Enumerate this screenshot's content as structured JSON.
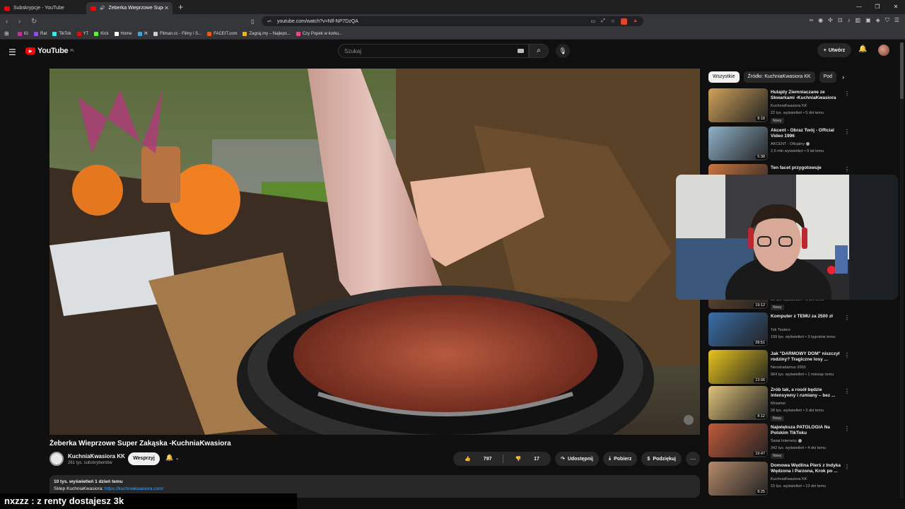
{
  "browser": {
    "tabs": [
      {
        "title": "Subskrypcje - YouTube",
        "active": false
      },
      {
        "title": "Żeberka Wieprzowe Super Za",
        "active": true
      }
    ],
    "new_tab": "+",
    "window_controls": [
      "—",
      "❐",
      "✕"
    ],
    "url": "youtube.com/watch?v=Nlf-NP7DzQA",
    "bookmarks": [
      {
        "label": "IG",
        "color": "#d6249f"
      },
      {
        "label": "Rat",
        "color": "#9146ff"
      },
      {
        "label": "TikTok",
        "color": "#25f4ee"
      },
      {
        "label": "YT",
        "color": "#ff0000"
      },
      {
        "label": "Kick",
        "color": "#53fc18"
      },
      {
        "label": "Home",
        "color": "#ffffff"
      },
      {
        "label": "Ж",
        "color": "#3aa7e0"
      },
      {
        "label": "Filman.cc - Filmy i S...",
        "color": "#cccccc"
      },
      {
        "label": "FACEIT.com",
        "color": "#ff5500"
      },
      {
        "label": "Zagraj.my – Najleps...",
        "color": "#f5b400"
      },
      {
        "label": "Czy Popek w korku...",
        "color": "#ff3b8d"
      }
    ]
  },
  "youtube": {
    "logo": "YouTube",
    "region": "PL",
    "search_placeholder": "Szukaj",
    "create_label": "Utwórz"
  },
  "video": {
    "title": "Żeberka Wieprzowe Super Zakąska -KuchniaKwasiora",
    "channel": "KuchniaKwasiora KK",
    "subscribers": "261 tys. subskrybentów",
    "support_label": "Wesprzyj",
    "likes": "797",
    "dislikes": "17",
    "share_label": "Udostępnij",
    "download_label": "Pobierz",
    "thanks_label": "Podziękuj",
    "description_stats": "10 tys. wyświetleń  1 dzień temu",
    "description_line": "Sklep KuchniaKwasiora: ",
    "description_link": "https://kuchniakwasiora.com/"
  },
  "chips": [
    "Wszystkie",
    "Źródło: KuchniaKwasiora KK",
    "Pod"
  ],
  "recommendations": [
    {
      "title": "Hulajdy Ziemniaczane ze Skwarkami -KuchniaKwasiora",
      "channel": "KuchniaKwasiora KK",
      "meta": "22 tys. wyświetleń • 5 dni temu",
      "duration": "8:18",
      "badge": "Nowy",
      "verified": false,
      "thumb": "#cfa15a"
    },
    {
      "title": "Akcent - Obraz Twój - Official Video 1996",
      "channel": "AKCENT - Oficjalny",
      "meta": "2,6 mln wyświetleń • 9 lat temu",
      "duration": "5:38",
      "badge": "",
      "verified": true,
      "thumb": "#8fb2c9"
    },
    {
      "title": "Ten facet przygotowuje",
      "channel": "",
      "meta": "",
      "duration": "",
      "badge": "",
      "verified": false,
      "thumb": "#c9763e"
    },
    {
      "title": "",
      "channel": "",
      "meta": "",
      "duration": "",
      "badge": "",
      "verified": false,
      "thumb": "#555555"
    },
    {
      "title": "",
      "channel": "",
      "meta": "25 tys. wyświetleń • 6 dni temu",
      "duration": "19:12",
      "badge": "Nowy",
      "verified": false,
      "thumb": "#6b4a2e"
    },
    {
      "title": "Komputer z TEMU za 2500 zł",
      "channel": "Tek Testers",
      "meta": "199 tys. wyświetleń • 3 tygodnie temu",
      "duration": "28:51",
      "badge": "",
      "verified": false,
      "thumb": "#3a6ea8"
    },
    {
      "title": "Jak \"DARMOWY DOM\" niszczył rodziny? Tragiczne losy ...",
      "channel": "Neostradamus 2000",
      "meta": "964 tys. wyświetleń • 1 miesiąc temu",
      "duration": "13:06",
      "badge": "",
      "verified": false,
      "thumb": "#e8c51c"
    },
    {
      "title": "Zrób tak, a rosół będzie intensywny i rumiany – bez ...",
      "channel": "Mniamer",
      "meta": "28 tys. wyświetleń • 3 dni temu",
      "duration": "8:12",
      "badge": "Nowy",
      "verified": false,
      "thumb": "#e0c27a"
    },
    {
      "title": "Największa PATOLOGIA Na Polskim TikToku",
      "channel": "Świat Internetu",
      "meta": "342 tys. wyświetleń • 4 dni temu",
      "duration": "19:47",
      "badge": "Nowy",
      "verified": true,
      "thumb": "#c05a3a"
    },
    {
      "title": "Domowa Wędlina Pierś z Indyka Wędzona i Parzona, Krok po ...",
      "channel": "KuchniaKwasiora KK",
      "meta": "15 tys. wyświetleń • 13 dni temu",
      "duration": "8:25",
      "badge": "",
      "verified": false,
      "thumb": "#b58a6a"
    }
  ],
  "chat_overlay": "nxzzz : z renty dostajesz 3k"
}
